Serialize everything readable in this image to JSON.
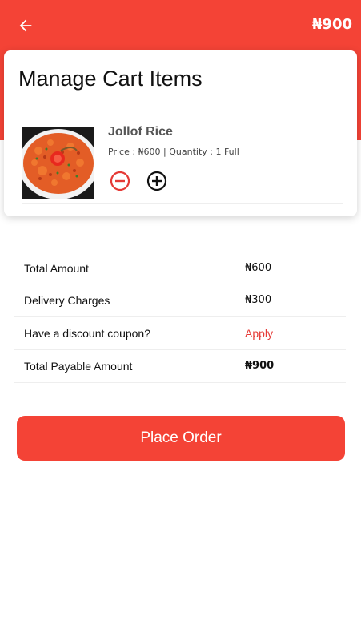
{
  "header": {
    "back_icon": "arrow-left-icon",
    "total": "₦900",
    "background_color": "#f44336"
  },
  "card": {
    "title": "Manage Cart Items",
    "item": {
      "name": "Jollof Rice",
      "meta": "Price : ₦600 | Quantity : 1 Full",
      "image": "jollof-rice-plate",
      "decrease_icon": "minus-circle-icon",
      "increase_icon": "plus-circle-icon"
    }
  },
  "summary": {
    "rows": [
      {
        "label": "Total Amount",
        "value": "₦600"
      },
      {
        "label": "Delivery Charges",
        "value": "₦300"
      },
      {
        "label": "Have a discount coupon?",
        "value": "Apply"
      },
      {
        "label": "Total Payable Amount",
        "value": "₦900"
      }
    ]
  },
  "actions": {
    "place_order_label": "Place Order",
    "accent_color": "#f44336"
  }
}
